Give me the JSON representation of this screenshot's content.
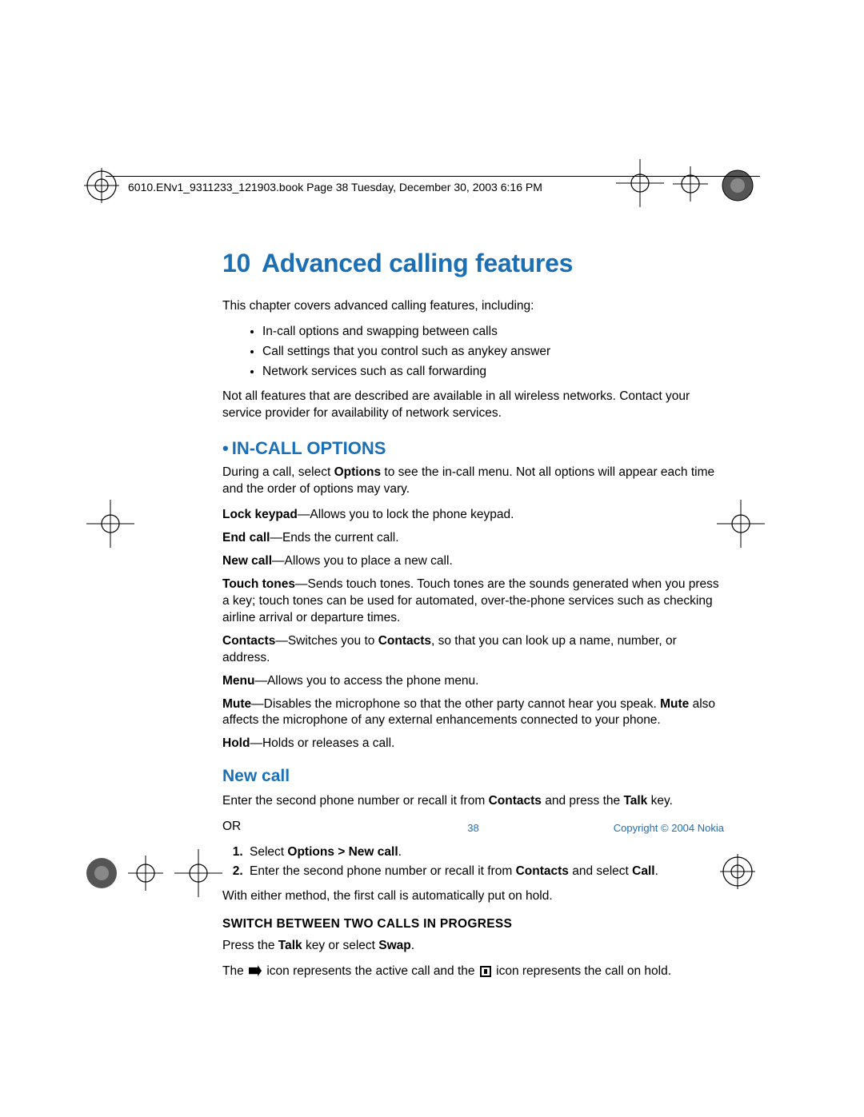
{
  "header": {
    "running": "6010.ENv1_9311233_121903.book  Page 38  Tuesday, December 30, 2003  6:16 PM"
  },
  "chapter": {
    "number": "10",
    "title": "Advanced calling features"
  },
  "intro": {
    "lead": "This chapter covers advanced calling features, including:",
    "bullets": [
      "In-call options and swapping between calls",
      "Call settings that you control such as anykey answer",
      "Network services such as call forwarding"
    ],
    "note": "Not all features that are described are available in all wireless networks. Contact your service provider for availability of network services."
  },
  "incall": {
    "heading": "IN-CALL OPTIONS",
    "intro_a": "During a call, select ",
    "intro_b": "Options",
    "intro_c": " to see the in-call menu. Not all options will appear each time and the order of options may vary.",
    "defs": [
      {
        "term": "Lock keypad",
        "text": "—Allows you to lock the phone keypad."
      },
      {
        "term": "End call",
        "text": "—Ends the current call."
      },
      {
        "term": "New call",
        "text": "—Allows you to place a new call."
      },
      {
        "term": "Touch tones",
        "text": "—Sends touch tones. Touch tones are the sounds generated when you press a key; touch tones can be used for automated, over-the-phone services such as checking airline arrival or departure times."
      },
      {
        "term": "Contacts",
        "text_a": "—Switches you to ",
        "bold": "Contacts",
        "text_b": ", so that you can look up a name, number, or address."
      },
      {
        "term": "Menu",
        "text": "—Allows you to access the phone menu."
      },
      {
        "term": "Mute",
        "text_a": "—Disables the microphone so that the other party cannot hear you speak. ",
        "bold": "Mute",
        "text_b": " also affects the microphone of any external enhancements connected to your phone."
      },
      {
        "term": "Hold",
        "text": "—Holds or releases a call."
      }
    ]
  },
  "newcall": {
    "heading": "New call",
    "p1_a": "Enter the second phone number or recall it from ",
    "p1_b": "Contacts",
    "p1_c": " and press the ",
    "p1_d": "Talk",
    "p1_e": " key.",
    "or": "OR",
    "step1_a": "Select ",
    "step1_b": "Options > New call",
    "step1_c": ".",
    "step2_a": "Enter the second phone number or recall it from ",
    "step2_b": "Contacts",
    "step2_c": " and select ",
    "step2_d": "Call",
    "step2_e": ".",
    "p2": "With either method, the first call is automatically put on hold."
  },
  "switch": {
    "heading": "SWITCH BETWEEN TWO CALLS IN PROGRESS",
    "p1_a": "Press the ",
    "p1_b": "Talk",
    "p1_c": " key or select ",
    "p1_d": "Swap",
    "p1_e": ".",
    "p2_a": "The ",
    "p2_b": " icon represents the active call and the ",
    "p2_c": " icon represents the call on hold."
  },
  "footer": {
    "page": "38",
    "copyright": "Copyright © 2004 Nokia"
  }
}
